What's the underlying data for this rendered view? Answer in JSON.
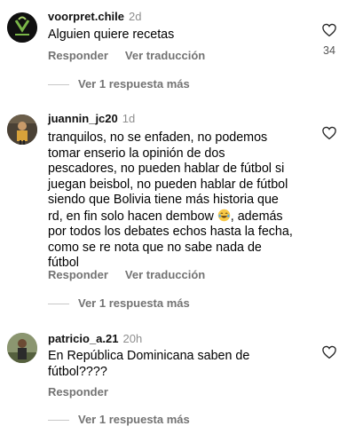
{
  "comments": [
    {
      "username": "voorpret.chile",
      "time": "2d",
      "lines": [
        "Alguien quiere recetas"
      ],
      "reply_label": "Responder",
      "translate_label": "Ver traducción",
      "view_replies": "Ver 1 respuesta más",
      "likes": "34"
    },
    {
      "username": "juannin_jc20",
      "time": "1d",
      "lines": [
        "tranquilos, no se enfaden, no podemos",
        "tomar enserio la opinión de dos",
        "pescadores, no pueden hablar de fútbol si",
        "juegan beisbol, no pueden hablar de fútbol",
        "siendo que Bolivia tiene más historia que",
        "rd, en fin solo hacen dembow",
        "por todos los debates echos hasta la fecha,",
        "como se re nota que no sabe nada de",
        "fútbol"
      ],
      "line6_tail": ", además",
      "emoji": "tears-of-joy-emoji",
      "reply_label": "Responder",
      "translate_label": "Ver traducción",
      "view_replies": "Ver 1 respuesta más"
    },
    {
      "username": "patricio_a.21",
      "time": "20h",
      "lines": [
        "En República Dominicana saben de",
        "fútbol????"
      ],
      "reply_label": "Responder",
      "view_replies": "Ver 1 respuesta más"
    }
  ],
  "colors": {
    "secondary_text": "#737373",
    "divider": "#c7c7c7"
  }
}
